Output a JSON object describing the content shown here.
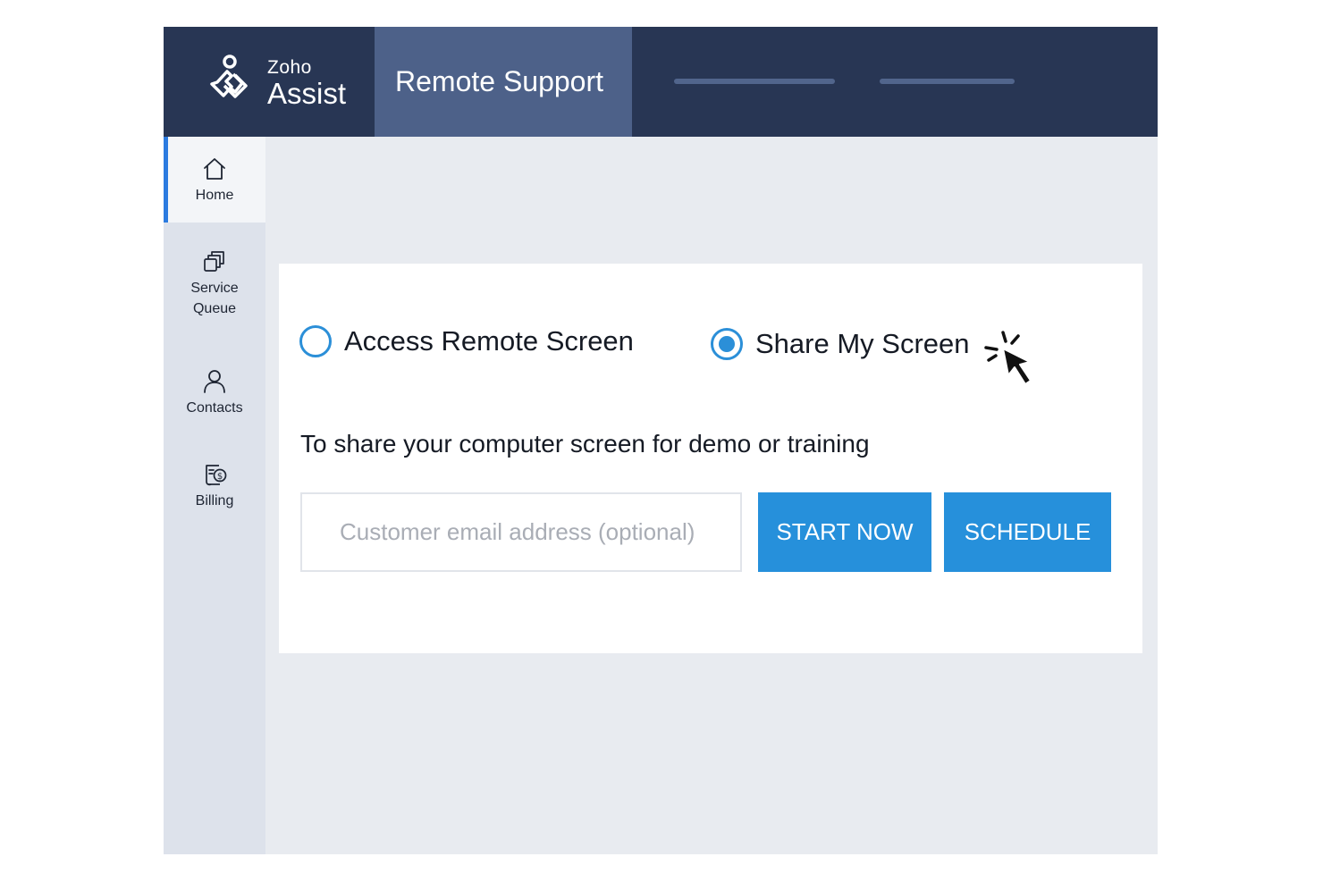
{
  "header": {
    "logo": {
      "brand": "Zoho",
      "product": "Assist",
      "icon": "zoho-assist-logo-icon"
    },
    "active_tab": "Remote Support",
    "placeholder_tabs": 2
  },
  "sidebar": {
    "items": [
      {
        "label": "Home",
        "icon": "home-icon",
        "active": true
      },
      {
        "label": "Service Queue",
        "line1": "Service",
        "line2": "Queue",
        "icon": "queue-icon"
      },
      {
        "label": "Contacts",
        "icon": "user-icon"
      },
      {
        "label": "Billing",
        "icon": "billing-icon"
      }
    ]
  },
  "main": {
    "options": [
      {
        "label": "Access Remote Screen",
        "selected": false
      },
      {
        "label": "Share My Screen",
        "selected": true
      }
    ],
    "description": "To share your computer screen for demo or training",
    "email_placeholder": "Customer email address (optional)",
    "start_label": "START NOW",
    "schedule_label": "SCHEDULE"
  },
  "colors": {
    "header": "#283654",
    "active_tab": "#4d6189",
    "accent": "#2690db",
    "sidebar": "#dde2eb",
    "content_bg": "#e8ebf0"
  }
}
